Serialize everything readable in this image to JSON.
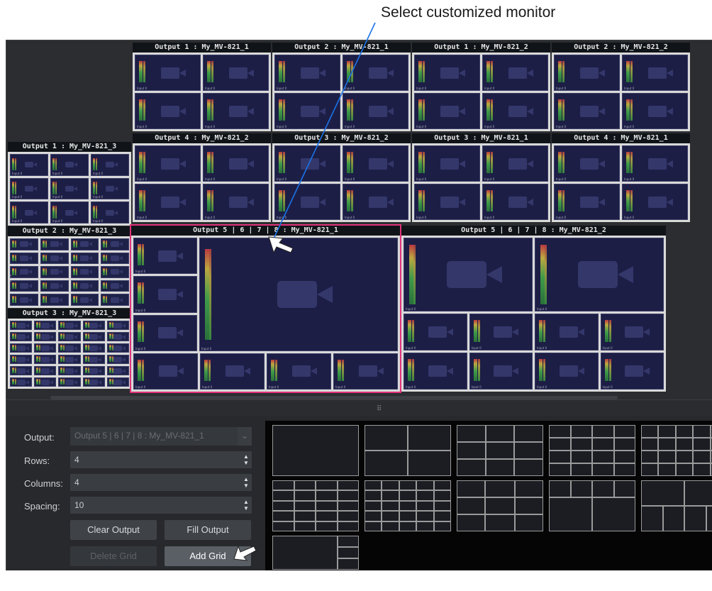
{
  "callout": {
    "text": "Select customized monitor"
  },
  "outputs": [
    {
      "id": "o1a",
      "title": "Output 1 : My_MV-821_1"
    },
    {
      "id": "o2a",
      "title": "Output 2 : My_MV-821_1"
    },
    {
      "id": "o1b",
      "title": "Output 1 : My_MV-821_2"
    },
    {
      "id": "o2b",
      "title": "Output 2 : My_MV-821_2"
    },
    {
      "id": "o4a",
      "title": "Output 4 : My_MV-821_2"
    },
    {
      "id": "o3a",
      "title": "Output 3 : My_MV-821_2"
    },
    {
      "id": "o3b",
      "title": "Output 3 : My_MV-821_1"
    },
    {
      "id": "o4b",
      "title": "Output 4 : My_MV-821_1"
    },
    {
      "id": "o1c",
      "title": "Output 1 : My_MV-821_3"
    },
    {
      "id": "o2c",
      "title": "Output 2 : My_MV-821_3"
    },
    {
      "id": "o3c",
      "title": "Output 3 : My_MV-821_3"
    },
    {
      "id": "o5a",
      "title": "Output 5 | 6 | 7 | 8 : My_MV-821_1"
    },
    {
      "id": "o5b",
      "title": "Output 5 | 6 | 7 | 8 : My_MV-821_2"
    }
  ],
  "tile_label": "Input 0",
  "form": {
    "output_label": "Output:",
    "output_value": "Output 5 | 6 | 7 | 8 : My_MV-821_1",
    "rows_label": "Rows:",
    "rows_value": "4",
    "columns_label": "Columns:",
    "columns_value": "4",
    "spacing_label": "Spacing:",
    "spacing_value": "10"
  },
  "buttons": {
    "clear_output": "Clear Output",
    "fill_output": "Fill Output",
    "delete_grid": "Delete Grid",
    "add_grid": "Add Grid"
  },
  "colors": {
    "selection": "#e0327a",
    "tile": "#1d1e46",
    "annotation_line": "#1a73e8"
  }
}
